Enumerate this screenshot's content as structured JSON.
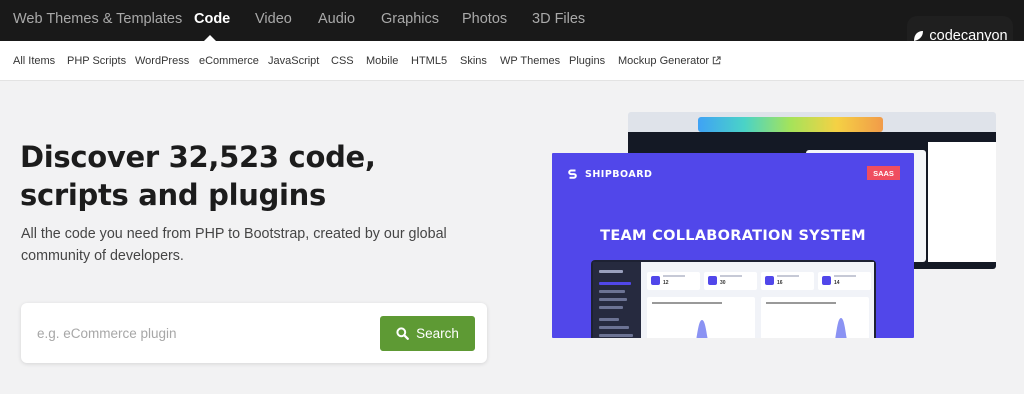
{
  "top_nav": {
    "items": [
      {
        "label": "Web Themes & Templates",
        "active": false
      },
      {
        "label": "Code",
        "active": true
      },
      {
        "label": "Video",
        "active": false
      },
      {
        "label": "Audio",
        "active": false
      },
      {
        "label": "Graphics",
        "active": false
      },
      {
        "label": "Photos",
        "active": false
      },
      {
        "label": "3D Files",
        "active": false
      }
    ],
    "brand": "codecanyon"
  },
  "sub_nav": {
    "items": [
      "All Items",
      "PHP Scripts",
      "WordPress",
      "eCommerce",
      "JavaScript",
      "CSS",
      "Mobile",
      "HTML5",
      "Skins",
      "WP Themes",
      "Plugins",
      "Mockup Generator"
    ]
  },
  "hero": {
    "title": "Discover 32,523 code, scripts and plugins",
    "subtitle": "All the code you need from PHP to Bootstrap, created by our global community of developers."
  },
  "search": {
    "placeholder": "e.g. eCommerce plugin",
    "button_label": "Search"
  },
  "promo": {
    "logo": "SHIPBOARD",
    "badge": "SAAS",
    "headline": "TEAM COLLABORATION SYSTEM",
    "stats": [
      "12",
      "30",
      "16",
      "14"
    ]
  },
  "colors": {
    "topbar": "#191919",
    "accent_green": "#5e9a34",
    "promo_purple": "#5147ea",
    "badge_red": "#ef4e5f"
  }
}
